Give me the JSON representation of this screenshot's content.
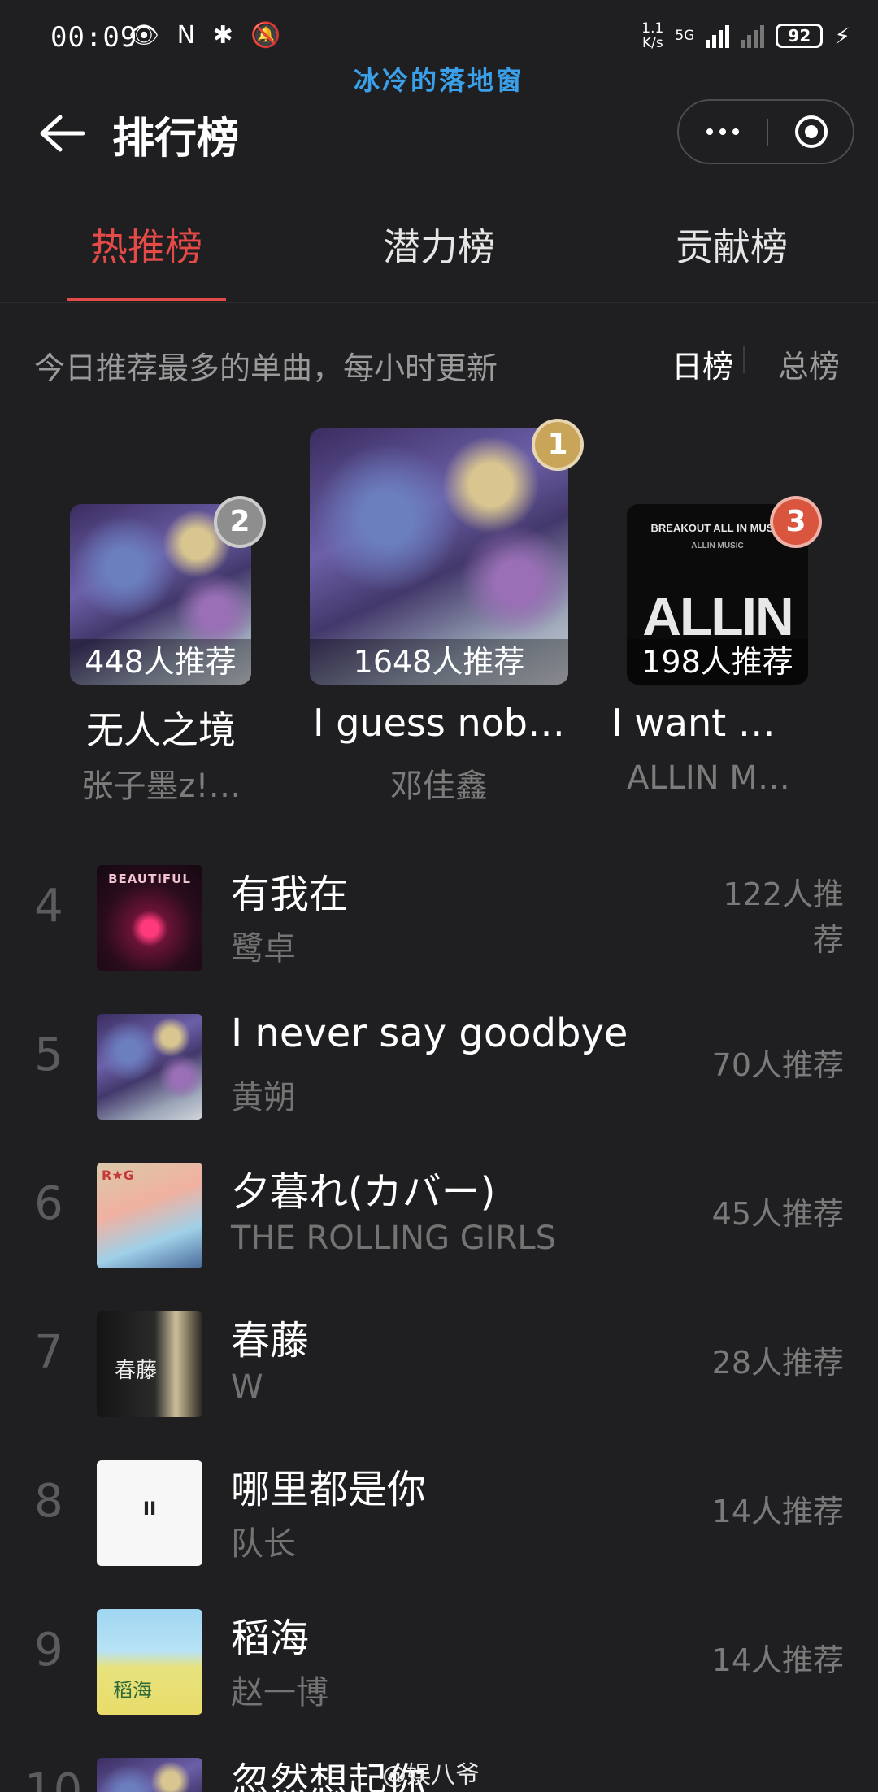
{
  "status_bar": {
    "time": "00:09",
    "left_icons": "👁 N ✱ 🔕",
    "net_speed_top": "1.1",
    "net_speed_bottom": "K/s",
    "network": "5G",
    "battery": "92"
  },
  "watermark_top": "冰冷的落地窗",
  "header": {
    "title": "排行榜"
  },
  "tabs": [
    {
      "label": "热推榜",
      "active": true
    },
    {
      "label": "潜力榜",
      "active": false
    },
    {
      "label": "贡献榜",
      "active": false
    }
  ],
  "subtitle": "今日推荐最多的单曲，每小时更新",
  "segments": {
    "day": "日榜",
    "total": "总榜"
  },
  "podium": [
    {
      "rank": "1",
      "count": "1648人推荐",
      "title": "I guess nob…",
      "artist": "邓佳鑫"
    },
    {
      "rank": "2",
      "count": "448人推荐",
      "title": "无人之境",
      "artist": "张子墨z!…"
    },
    {
      "rank": "3",
      "count": "198人推荐",
      "title": "I want …",
      "artist": "ALLIN M…",
      "cover_text_top": "BREAKOUT ALL IN MUSIC",
      "cover_text_sub": "ALLIN MUSIC",
      "cover_word": "ALLIN"
    }
  ],
  "songs": [
    {
      "rank": "4",
      "title": "有我在",
      "artist": "鹭卓",
      "count_line1": "122人推",
      "count_line2": "荐",
      "cover_text": "BEAUTIFUL"
    },
    {
      "rank": "5",
      "title": "I never say goodbye",
      "artist": "黄朔",
      "count": "70人推荐"
    },
    {
      "rank": "6",
      "title": "夕暮れ(カバー)",
      "artist": "THE ROLLING GIRLS",
      "count": "45人推荐",
      "cover_text": "R★G"
    },
    {
      "rank": "7",
      "title": "春藤",
      "artist": "W",
      "count": "28人推荐",
      "cover_text": "春藤"
    },
    {
      "rank": "8",
      "title": "哪里都是你",
      "artist": "队长",
      "count": "14人推荐",
      "cover_text": "II"
    },
    {
      "rank": "9",
      "title": "稻海",
      "artist": "赵一博",
      "count": "14人推荐",
      "cover_text": "稻海"
    },
    {
      "rank": "10",
      "title": "忽然想起你",
      "artist": "",
      "count": ""
    }
  ],
  "watermark_bottom": "@娱八爷",
  "colors": {
    "accent": "#e44a47",
    "background": "#1f1f21",
    "badge_gold": "#c9a55a",
    "badge_silver": "#9a9a9a",
    "badge_bronze": "#d9553e"
  }
}
